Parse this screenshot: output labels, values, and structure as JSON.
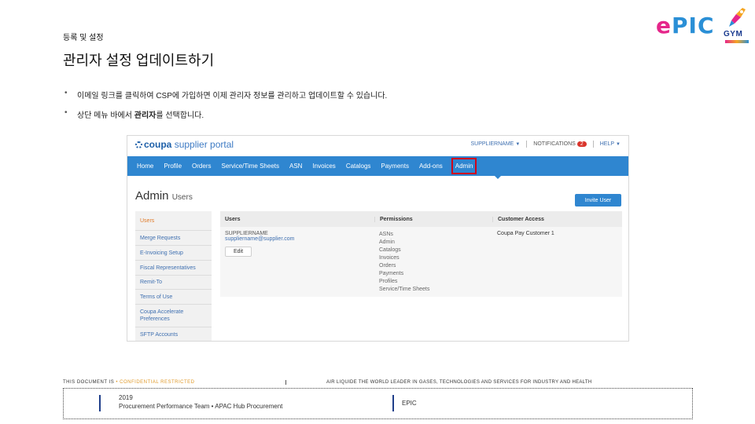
{
  "slide": {
    "section_label": "등록 및 설정",
    "title": "관리자 설정 업데이트하기",
    "bullets": [
      {
        "text": "이메일 링크를 클릭하여 CSP에 가입하면 이제 관리자 정보를 관리하고 업데이트할 수 있습니다."
      },
      {
        "pre": "상단 메뉴 바에서 ",
        "bold": "관리자",
        "post": "를 선택합니다."
      }
    ]
  },
  "logos": {
    "epic_e": "e",
    "epic_rest": "PIC",
    "gym": "GYM"
  },
  "portal": {
    "brand_coupa": "coupa",
    "brand_sp": "supplier portal",
    "top_links": {
      "user": "SUPPLIERNAME",
      "notifications": "NOTIFICATIONS",
      "notif_count": "2",
      "help": "HELP"
    },
    "nav": [
      "Home",
      "Profile",
      "Orders",
      "Service/Time Sheets",
      "ASN",
      "Invoices",
      "Catalogs",
      "Payments",
      "Add-ons"
    ],
    "nav_active": "Admin",
    "heading": "Admin",
    "heading_sub": "Users",
    "invite_button": "Invite User",
    "side_nav": [
      {
        "label": "Users",
        "active": true
      },
      {
        "label": "Merge Requests"
      },
      {
        "label": "E-Invoicing Setup"
      },
      {
        "label": "Fiscal Representatives"
      },
      {
        "label": "Remit-To"
      },
      {
        "label": "Terms of Use"
      },
      {
        "label": "Coupa Accelerate Preferences"
      },
      {
        "label": "SFTP Accounts"
      }
    ],
    "table": {
      "headers": [
        "Users",
        "Permissions",
        "Customer Access"
      ],
      "row": {
        "user_name": "SUPPLIERNAME",
        "user_email": "suppliername@supplier.com",
        "edit_label": "Edit",
        "permissions": [
          "ASNs",
          "Admin",
          "Catalogs",
          "Invoices",
          "Orders",
          "Payments",
          "Profiles",
          "Service/Time Sheets"
        ],
        "customer": "Coupa Pay Customer 1"
      }
    }
  },
  "footer": {
    "doc_prefix": "THIS DOCUMENT IS ",
    "doc_conf": "• CONFIDENTIAL RESTRICTED",
    "tagline": "AIR LIQUIDE THE WORLD LEADER IN GASES, TECHNOLOGIES AND SERVICES FOR INDUSTRY AND HEALTH",
    "year": "2019",
    "team": "Procurement Performance Team • APAC Hub Procurement",
    "epic": "EPIC"
  }
}
